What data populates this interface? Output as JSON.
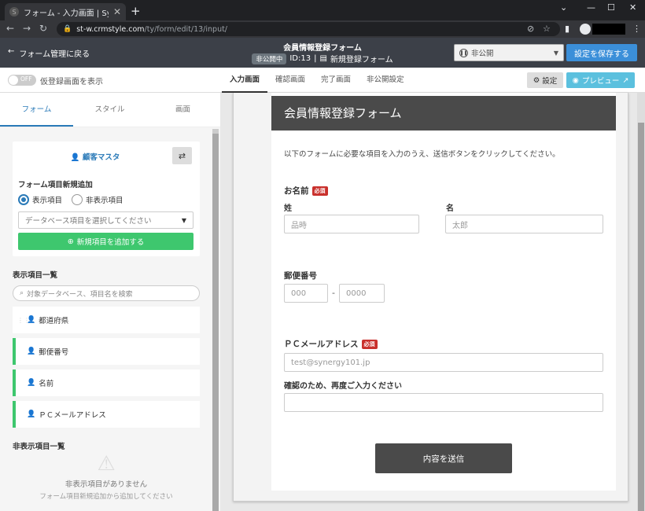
{
  "browser": {
    "tab_title": "フォーム - 入力画面 | Synergy!",
    "url_host": "st-w.crmstyle.com",
    "url_path": "/ty/form/edit/13/input/"
  },
  "header": {
    "back_label": "フォーム管理に戻る",
    "form_title": "会員情報登録フォーム",
    "status_pill": "非公開中",
    "form_id": "ID:13",
    "form_name": "新規登録フォーム",
    "status_select": "非公開",
    "save_label": "設定を保存する"
  },
  "subbar": {
    "toggle_state": "OFF",
    "toggle_label": "仮登録画面を表示",
    "tabs": [
      "入力画面",
      "確認画面",
      "完了画面",
      "非公開設定"
    ],
    "settings_label": "設定",
    "preview_label": "プレビュー"
  },
  "left": {
    "tabs": [
      "フォーム",
      "スタイル",
      "画面"
    ],
    "master_label": "顧客マスタ",
    "new_item_title": "フォーム項目新規追加",
    "radio_visible": "表示項目",
    "radio_hidden": "非表示項目",
    "db_placeholder": "データベース項目を選択してください",
    "add_button": "新規項目を追加する",
    "visible_list_title": "表示項目一覧",
    "search_placeholder": "対象データベース、項目名を検索",
    "visible_items": [
      "都道府県",
      "郵便番号",
      "名前",
      "ＰＣメールアドレス"
    ],
    "hidden_list_title": "非表示項目一覧",
    "empty_title": "非表示項目がありません",
    "empty_hint": "フォーム項目新規追加から追加してください"
  },
  "form": {
    "title": "会員情報登録フォーム",
    "intro": "以下のフォームに必要な項目を入力のうえ、送信ボタンをクリックしてください。",
    "name_label": "お名前",
    "required": "必須",
    "last_name_label": "姓",
    "last_name_placeholder": "品時",
    "first_name_label": "名",
    "first_name_placeholder": "太郎",
    "zip_label": "郵便番号",
    "zip1_placeholder": "000",
    "zip_sep": "-",
    "zip2_placeholder": "0000",
    "email_label": "ＰＣメールアドレス",
    "email_placeholder": "test@synergy101.jp",
    "confirm_label": "確認のため、再度ご入力ください",
    "confirm_placeholder": "",
    "submit_label": "内容を送信"
  }
}
